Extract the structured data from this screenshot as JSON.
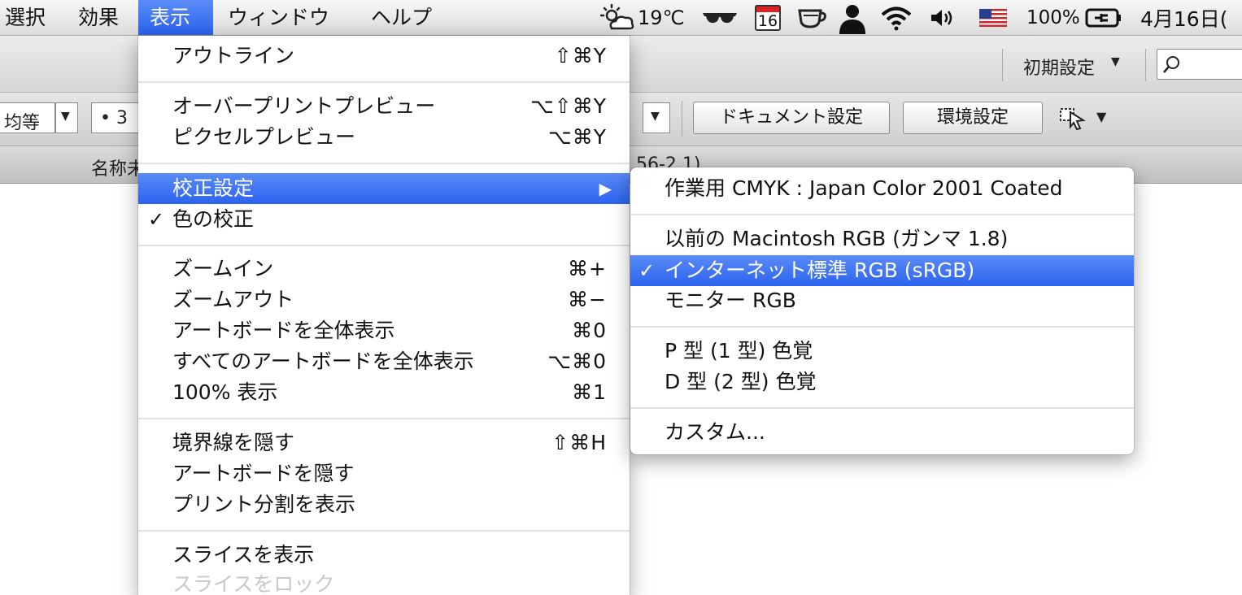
{
  "menubar": {
    "items": [
      "選択",
      "効果",
      "表示",
      "ウィンドウ",
      "ヘルプ"
    ],
    "active_index": 2,
    "status": {
      "weather": "19℃",
      "calendar_day": "16",
      "battery": "100%",
      "date": "4月16日("
    }
  },
  "toolbar": {
    "workspace": "初期設定",
    "document_setup": "ドキュメント設定",
    "preferences": "環境設定",
    "left_select": "均等",
    "bullet_field": "•  3",
    "doc_title": "名称未",
    "doc_title_tail": "56-2.1)"
  },
  "view_menu": {
    "items": [
      {
        "label": "アウトライン",
        "shortcut": "⇧⌘Y"
      },
      {
        "label": "オーバープリントプレビュー",
        "shortcut": "⌥⇧⌘Y"
      },
      {
        "label": "ピクセルプレビュー",
        "shortcut": "⌥⌘Y"
      },
      {
        "label": "校正設定",
        "submenu_arrow": "▶"
      },
      {
        "label": "色の校正",
        "check": "✓"
      },
      {
        "label": "ズームイン",
        "shortcut": "⌘+"
      },
      {
        "label": "ズームアウト",
        "shortcut": "⌘−"
      },
      {
        "label": "アートボードを全体表示",
        "shortcut": "⌘0"
      },
      {
        "label": "すべてのアートボードを全体表示",
        "shortcut": "⌥⌘0"
      },
      {
        "label": "100% 表示",
        "shortcut": "⌘1"
      },
      {
        "label": "境界線を隠す",
        "shortcut": "⇧⌘H"
      },
      {
        "label": "アートボードを隠す"
      },
      {
        "label": "プリント分割を表示"
      },
      {
        "label": "スライスを表示"
      },
      {
        "label": "スライスをロック"
      }
    ]
  },
  "proof_submenu": {
    "items": [
      {
        "label": "作業用 CMYK : Japan Color 2001 Coated"
      },
      {
        "label": "以前の Macintosh RGB (ガンマ 1.8)"
      },
      {
        "label": "インターネット標準 RGB (sRGB)",
        "check": "✓"
      },
      {
        "label": "モニター RGB"
      },
      {
        "label": "P 型 (1 型) 色覚"
      },
      {
        "label": "D 型 (2 型) 色覚"
      },
      {
        "label": "カスタム..."
      }
    ]
  },
  "colors": {
    "highlight": "#2c63ef",
    "menubar": "#e6e6e6"
  }
}
